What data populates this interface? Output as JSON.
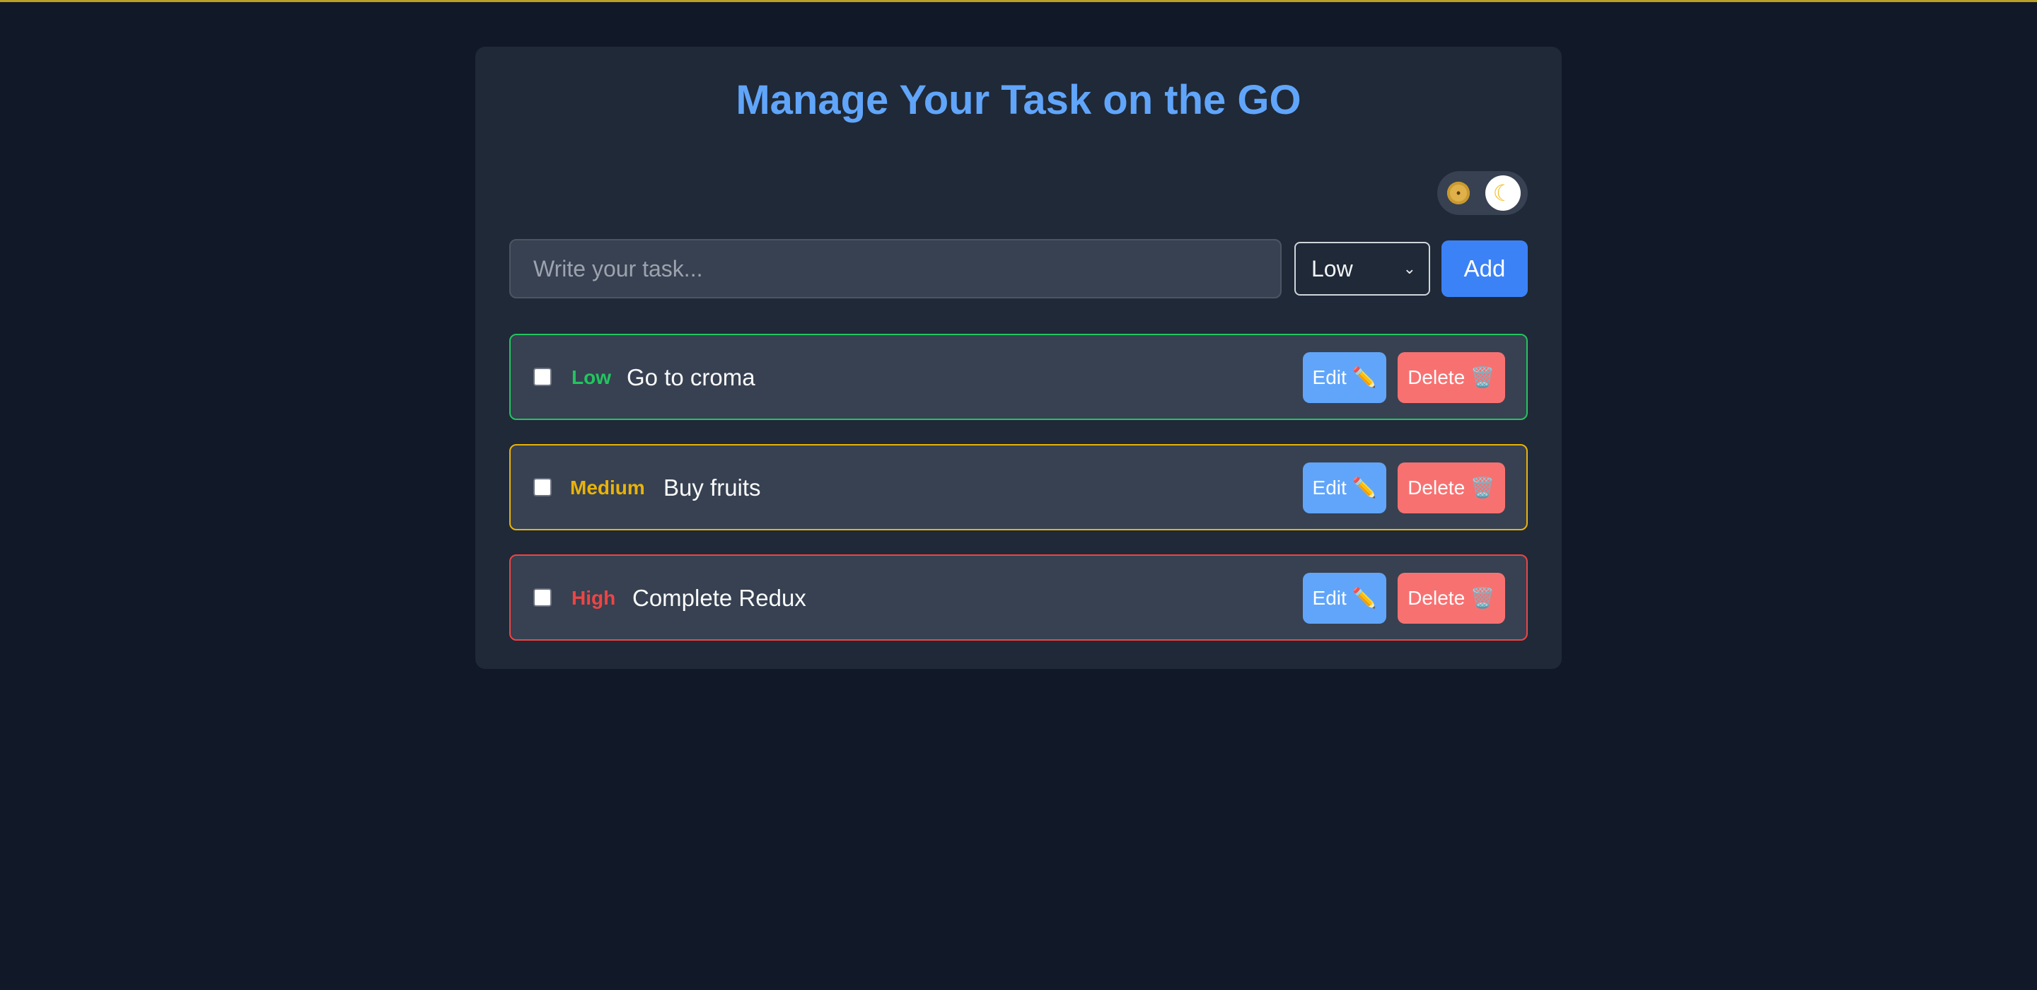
{
  "header": {
    "title": "Manage Your Task on the GO"
  },
  "theme_toggle": {
    "light_icon": "sun-icon",
    "dark_icon": "moon-icon",
    "sun_glyph": "•",
    "moon_glyph": "☾",
    "state": "dark"
  },
  "form": {
    "input_value": "",
    "input_placeholder": "Write your task...",
    "priority_selected": "Low",
    "add_label": "Add"
  },
  "colors": {
    "low": "#22c55e",
    "medium": "#eab308",
    "high": "#ef4444",
    "edit": "#60a5fa",
    "delete": "#f87171",
    "accent": "#3b82f6"
  },
  "tasks": [
    {
      "priority": "Low",
      "text": "Go to croma",
      "completed": false,
      "edit_label": "Edit ✏️",
      "delete_label": "Delete 🗑️"
    },
    {
      "priority": "Medium",
      "text": "Buy fruits",
      "completed": false,
      "edit_label": "Edit ✏️",
      "delete_label": "Delete 🗑️"
    },
    {
      "priority": "High",
      "text": "Complete Redux",
      "completed": false,
      "edit_label": "Edit ✏️",
      "delete_label": "Delete 🗑️"
    }
  ]
}
